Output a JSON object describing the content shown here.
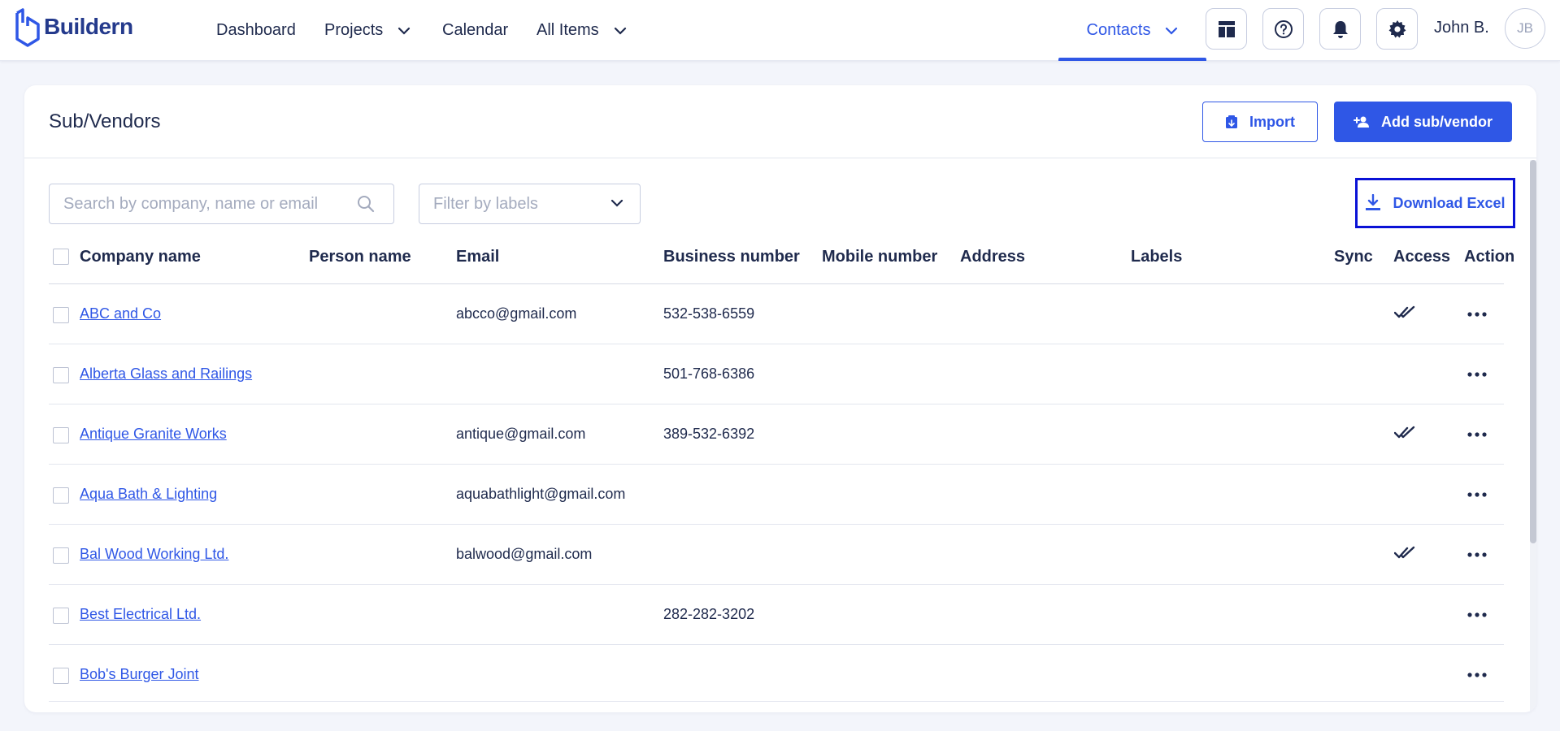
{
  "brand": {
    "name": "Buildern"
  },
  "nav": {
    "dashboard": "Dashboard",
    "projects": "Projects",
    "calendar": "Calendar",
    "all_items": "All Items",
    "contacts": "Contacts"
  },
  "user": {
    "name": "John B.",
    "initials": "JB"
  },
  "page": {
    "title": "Sub/Vendors",
    "import_label": "Import",
    "add_label": "Add sub/vendor",
    "search_placeholder": "Search by company, name or email",
    "filter_placeholder": "Filter by labels",
    "download_label": "Download Excel"
  },
  "table": {
    "headers": {
      "company": "Company name",
      "person": "Person name",
      "email": "Email",
      "business": "Business number",
      "mobile": "Mobile number",
      "address": "Address",
      "labels": "Labels",
      "sync": "Sync",
      "access": "Access",
      "action": "Action"
    },
    "rows": [
      {
        "company": "ABC and Co",
        "person": "",
        "email": "abcco@gmail.com",
        "business": "532-538-6559",
        "mobile": "",
        "address": "",
        "labels": "",
        "access": true
      },
      {
        "company": "Alberta Glass and Railings",
        "person": "",
        "email": "",
        "business": "501-768-6386",
        "mobile": "",
        "address": "",
        "labels": "",
        "access": false
      },
      {
        "company": "Antique Granite Works",
        "person": "",
        "email": "antique@gmail.com",
        "business": "389-532-6392",
        "mobile": "",
        "address": "",
        "labels": "",
        "access": true
      },
      {
        "company": "Aqua Bath & Lighting",
        "person": "",
        "email": "aquabathlight@gmail.com",
        "business": "",
        "mobile": "",
        "address": "",
        "labels": "",
        "access": false
      },
      {
        "company": "Bal Wood Working Ltd.",
        "person": "",
        "email": "balwood@gmail.com",
        "business": "",
        "mobile": "",
        "address": "",
        "labels": "",
        "access": true
      },
      {
        "company": "Best Electrical Ltd.",
        "person": "",
        "email": "",
        "business": "282-282-3202",
        "mobile": "",
        "address": "",
        "labels": "",
        "access": false
      },
      {
        "company": "Bob's Burger Joint",
        "person": "",
        "email": "",
        "business": "",
        "mobile": "",
        "address": "",
        "labels": "",
        "access": false
      }
    ]
  },
  "colors": {
    "accent": "#2f57e6",
    "text": "#1f2a4d",
    "download_highlight": "#0a12d6",
    "background": "#f3f5fb"
  },
  "icons": {
    "logo": "buildern-logo-icon",
    "dashboard_btn": "dashboard-layout-icon",
    "help_btn": "help-icon",
    "bell_btn": "bell-icon",
    "gear_btn": "gear-icon",
    "import": "import-icon",
    "add": "add-user-icon",
    "download": "download-icon",
    "search": "search-icon",
    "access": "double-check-icon",
    "action": "more-icon"
  }
}
